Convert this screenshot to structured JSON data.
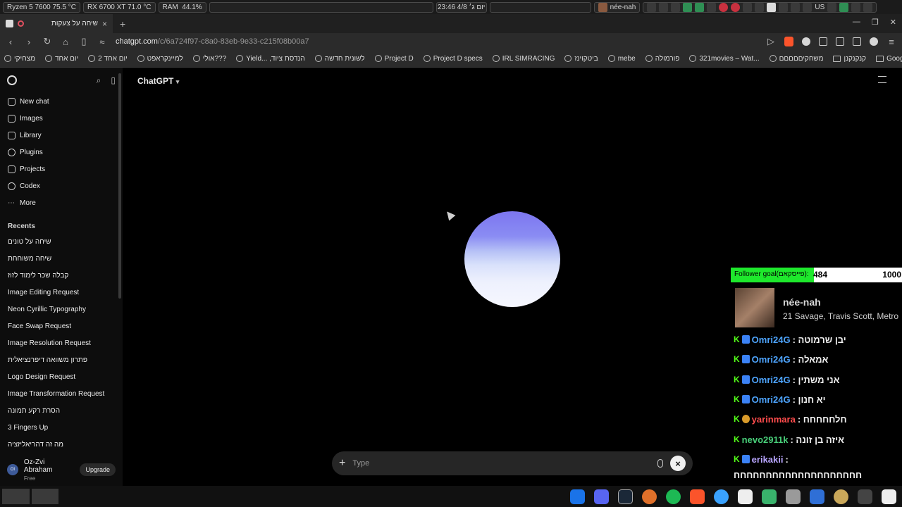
{
  "sysbar": {
    "cpu": "Ryzen 5 7600  75.5 °C",
    "gpu": "RX 6700 XT  71.0 °C",
    "ram_label": "RAM",
    "ram_value": "44.1%",
    "clock": "23:46 יום ג׳ 4/8",
    "stream_label": "née-nah",
    "lang": "US"
  },
  "tab": {
    "title": "שיחה על צעקות",
    "close": "×",
    "new_tab": "+"
  },
  "addr": {
    "url_host": "chatgpt.com",
    "url_path": "/c/6a724f97-c8a0-83eb-9e33-c215f08b00a7"
  },
  "bookmarks": [
    {
      "label": "מצחיקי",
      "kind": "site"
    },
    {
      "label": "יום אחד",
      "kind": "site"
    },
    {
      "label": "יום אחד 2",
      "kind": "site"
    },
    {
      "label": "למיינקראפט",
      "kind": "site"
    },
    {
      "label": "אולי???",
      "kind": "site"
    },
    {
      "label": "Yield... ,הנדסת ציוד",
      "kind": "site"
    },
    {
      "label": "לשונית חדשה",
      "kind": "site"
    },
    {
      "label": "Project D",
      "kind": "site"
    },
    {
      "label": "Project D specs",
      "kind": "site"
    },
    {
      "label": "IRL SIMRACING",
      "kind": "site"
    },
    {
      "label": "ביטקוינז",
      "kind": "site"
    },
    {
      "label": "mebe",
      "kind": "site"
    },
    {
      "label": "פורמולה",
      "kind": "site"
    },
    {
      "label": "321movies – Wat...",
      "kind": "site"
    },
    {
      "label": "משחקיםםםםם",
      "kind": "site"
    },
    {
      "label": "קנקנקנן",
      "kind": "folder"
    },
    {
      "label": "Google",
      "kind": "folder"
    }
  ],
  "sidebar": {
    "nav": [
      {
        "label": "New chat",
        "icon": "compose-icon"
      },
      {
        "label": "Images",
        "icon": "images-icon"
      },
      {
        "label": "Library",
        "icon": "library-icon"
      },
      {
        "label": "Plugins",
        "icon": "plugins-icon"
      },
      {
        "label": "Projects",
        "icon": "folder-icon"
      },
      {
        "label": "Codex",
        "icon": "codex-icon"
      },
      {
        "label": "More",
        "icon": "more-icon"
      }
    ],
    "recents_title": "Recents",
    "recents": [
      {
        "label": "שיחה על טונים",
        "rtl": true
      },
      {
        "label": "שיחה משוחחת",
        "rtl": true
      },
      {
        "label": "קבלה שכר לימוד לזוז",
        "rtl": true
      },
      {
        "label": "Image Editing Request",
        "rtl": false
      },
      {
        "label": "Neon Cyrillic Typography",
        "rtl": false
      },
      {
        "label": "Face Swap Request",
        "rtl": false
      },
      {
        "label": "Image Resolution Request",
        "rtl": false
      },
      {
        "label": "פתרון משוואה דיפרנציאלית",
        "rtl": true
      },
      {
        "label": "Logo Design Request",
        "rtl": false
      },
      {
        "label": "Image Transformation Request",
        "rtl": false
      },
      {
        "label": "הסרת רקע תמונה",
        "rtl": true
      },
      {
        "label": "3 Fingers Up",
        "rtl": false
      },
      {
        "label": "מה זה דהריאליזציה",
        "rtl": true
      }
    ],
    "user": {
      "initials": "OI",
      "name": "Oz-Zvi Abraham",
      "plan": "Free",
      "upgrade": "Upgrade"
    }
  },
  "main": {
    "model": "ChatGPT",
    "input_placeholder": "Type",
    "close_label": "×"
  },
  "overlay": {
    "goal_label": "Follower goal(פייסקאם):",
    "goal_current": "484",
    "goal_target": "1000",
    "goal_fraction": 0.484,
    "song": "née-nah",
    "artist": "21 Savage, Travis Scott, Metro",
    "messages": [
      {
        "user": "Omri24G",
        "text": ": יבן שרמוטה",
        "color": "blue"
      },
      {
        "user": "Omri24G",
        "text": ": אמאלה",
        "color": "blue"
      },
      {
        "user": "Omri24G",
        "text": ": אני משתין",
        "color": "blue"
      },
      {
        "user": "Omri24G",
        "text": ": יא חנון",
        "color": "blue"
      },
      {
        "user": "yarinmara",
        "text": ": חלחחחחח",
        "color": "red"
      },
      {
        "user": "nevo2911k",
        "text": ": איזה בן זונה",
        "color": "green"
      },
      {
        "user": "erikakii",
        "text": ":",
        "color": "violet"
      }
    ],
    "continuation": "חחחחחחחחחחחחחחחחחחחח"
  }
}
